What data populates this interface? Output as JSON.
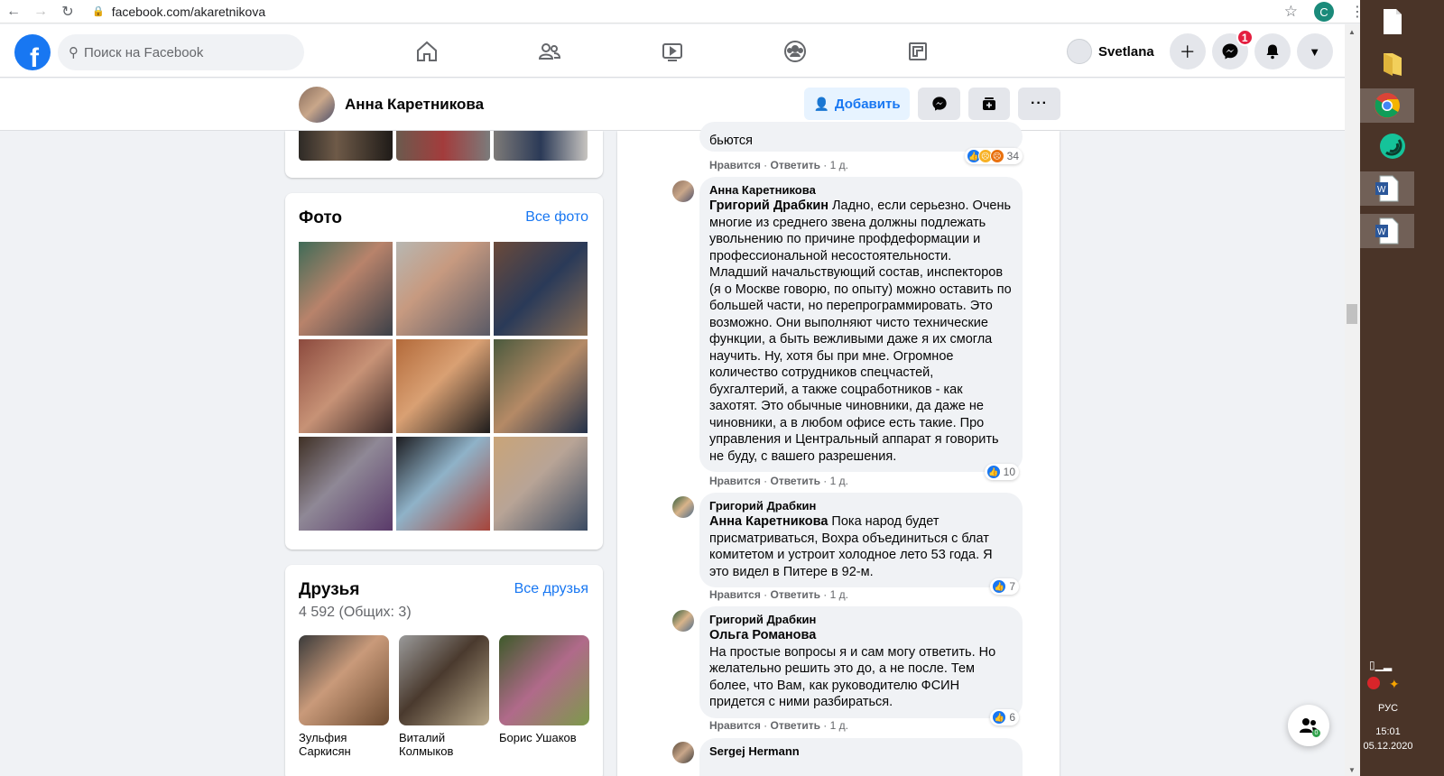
{
  "browser": {
    "url": "facebook.com/akaretnikova",
    "profile_initial": "C"
  },
  "nav": {
    "search_placeholder": "Поиск на Facebook",
    "user_name": "Svetlana",
    "messenger_badge": "1",
    "icons": [
      "home-icon",
      "friends-icon",
      "watch-icon",
      "groups-icon",
      "gaming-icon"
    ]
  },
  "profile": {
    "name": "Анна Каретникова",
    "add_label": "Добавить"
  },
  "photos": {
    "title": "Фото",
    "all_link": "Все фото"
  },
  "friends": {
    "title": "Друзья",
    "all_link": "Все друзья",
    "count": "4 592 (Общих: 3)",
    "items": [
      {
        "name": "Зульфия Саркисян"
      },
      {
        "name": "Виталий Колмыков"
      },
      {
        "name": "Борис Ушаков"
      }
    ]
  },
  "comments": {
    "like_label": "Нравится",
    "reply_label": "Ответить",
    "first": {
      "text": "бьются",
      "time": "1 д.",
      "reacts": "34"
    },
    "items": [
      {
        "author": "Анна Каретникова",
        "mention": "Григорий Драбкин",
        "text": " Ладно, если серьезно. Очень многие из среднего звена должны подлежать увольнению по причине профдеформации и профессиональной несостоятельности. Младший начальствующий состав, инспекторов (я о Москве говорю, по опыту) можно оставить по большей части, но перепрограммировать. Это возможно. Они выполняют чисто технические функции, а быть вежливыми даже я их смогла научить. Ну, хотя бы при мне. Огромное количество сотрудников спецчастей, бухгалтерий, а также соцработников - как захотят. Это обычные чиновники, да даже не чиновники, а в любом офисе есть такие. Про управления и Центральный аппарат я говорить не буду, с вашего разрешения.",
        "time": "1 д.",
        "reacts": "10"
      },
      {
        "author": "Григорий Драбкин",
        "mention": "Анна Каретникова",
        "text": " Пока народ будет присматриваться, Вохра объединиться с блат комитетом и устроит холодное лето 53 года. Я это видел в Питере в 92-м.",
        "time": "1 д.",
        "reacts": "7"
      },
      {
        "author": "Григорий Драбкин",
        "mention": "Ольга Романова",
        "text": "На простые вопросы я и сам могу ответить. Но желательно решить это до, а не после. Тем более, что Вам, как руководителю ФСИН придется с ними разбираться.",
        "time": "1 д.",
        "reacts": "6"
      },
      {
        "author": "Sergej Hermann"
      }
    ]
  },
  "taskbar": {
    "lang": "РУС",
    "time": "15:01",
    "date": "05.12.2020"
  },
  "chat_count": "0"
}
